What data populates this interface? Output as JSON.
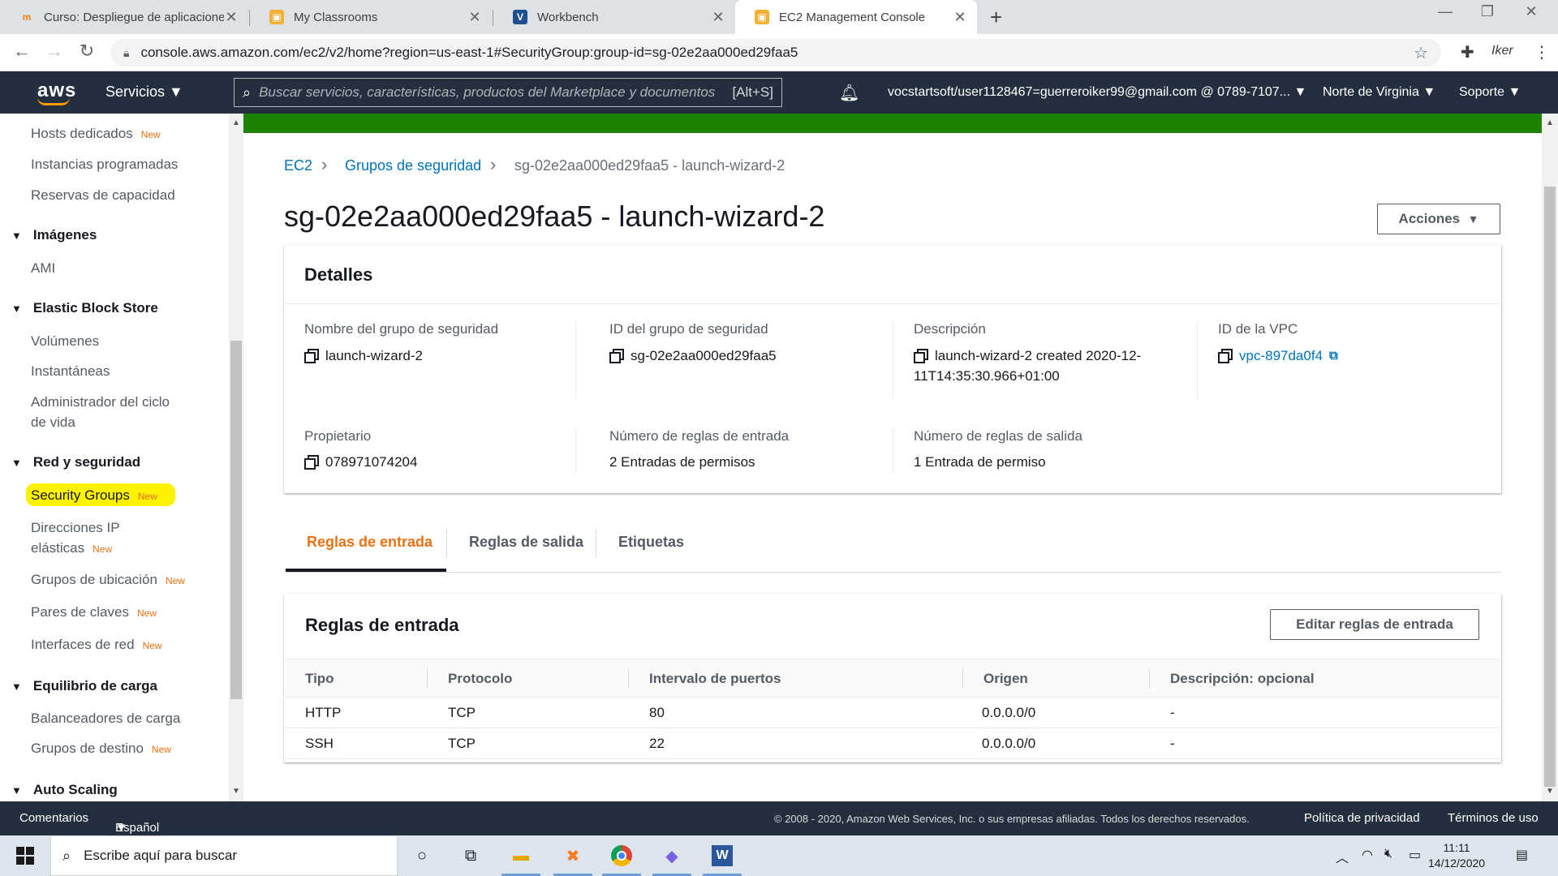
{
  "browser": {
    "tabs": [
      {
        "title": "Curso: Despliegue de aplicacione",
        "icon": "moodle-icon"
      },
      {
        "title": "My Classrooms",
        "icon": "aws-box-icon"
      },
      {
        "title": "Workbench",
        "icon": "vocareum-icon"
      },
      {
        "title": "EC2 Management Console",
        "icon": "aws-box-icon"
      }
    ],
    "url": "console.aws.amazon.com/ec2/v2/home?region=us-east-1#SecurityGroup:group-id=sg-02e2aa000ed29faa5",
    "profile_text": "Iker"
  },
  "aws_header": {
    "logo": "aws",
    "services": "Servicios",
    "search_placeholder": "Buscar servicios, características, productos del Marketplace y documentos",
    "search_shortcut": "[Alt+S]",
    "account": "vocstartsoft/user1128467=guerreroiker99@gmail.com @ 0789-7107...",
    "region": "Norte de Virginia",
    "support": "Soporte"
  },
  "sidebar": {
    "items": [
      {
        "label": "Hosts dedicados",
        "new": "New"
      },
      {
        "label": "Instancias programadas"
      },
      {
        "label": "Reservas de capacidad"
      }
    ],
    "sections": [
      {
        "title": "Imágenes",
        "items": [
          "AMI"
        ]
      },
      {
        "title": "Elastic Block Store",
        "items": [
          "Volúmenes",
          "Instantáneas",
          "Administrador del ciclo",
          "de vida"
        ]
      },
      {
        "title": "Red y seguridad"
      },
      {
        "title": "Equilibrio de carga"
      },
      {
        "title": "Auto Scaling"
      }
    ],
    "network": {
      "security_groups": "Security Groups",
      "eip_line1": "Direcciones IP",
      "eip_line2": "elásticas",
      "placement": "Grupos de ubicación",
      "keypairs": "Pares de claves",
      "interfaces": "Interfaces de red"
    },
    "lb": {
      "balancers": "Balanceadores de carga",
      "targets": "Grupos de destino"
    },
    "new_badge": "New"
  },
  "breadcrumb": {
    "ec2": "EC2",
    "groups": "Grupos de seguridad",
    "current": "sg-02e2aa000ed29faa5 - launch-wizard-2"
  },
  "page": {
    "title": "sg-02e2aa000ed29faa5 - launch-wizard-2",
    "actions": "Acciones"
  },
  "details": {
    "heading": "Detalles",
    "name_label": "Nombre del grupo de seguridad",
    "name_value": "launch-wizard-2",
    "id_label": "ID del grupo de seguridad",
    "id_value": "sg-02e2aa000ed29faa5",
    "desc_label": "Descripción",
    "desc_line1": "launch-wizard-2 created 2020-12-",
    "desc_line2": "11T14:35:30.966+01:00",
    "vpc_label": "ID de la VPC",
    "vpc_value": "vpc-897da0f4",
    "owner_label": "Propietario",
    "owner_value": "078971074204",
    "inbound_count_label": "Número de reglas de entrada",
    "inbound_count_value": "2 Entradas de permisos",
    "outbound_count_label": "Número de reglas de salida",
    "outbound_count_value": "1 Entrada de permiso"
  },
  "tabs": [
    "Reglas de entrada",
    "Reglas de salida",
    "Etiquetas"
  ],
  "rules": {
    "heading": "Reglas de entrada",
    "edit_button": "Editar reglas de entrada",
    "columns": [
      "Tipo",
      "Protocolo",
      "Intervalo de puertos",
      "Origen",
      "Descripción: opcional"
    ],
    "rows": [
      [
        "HTTP",
        "TCP",
        "80",
        "0.0.0.0/0",
        "-"
      ],
      [
        "SSH",
        "TCP",
        "22",
        "0.0.0.0/0",
        "-"
      ]
    ]
  },
  "footer": {
    "feedback": "Comentarios",
    "language": "Español",
    "copyright": "© 2008 - 2020, Amazon Web Services, Inc. o sus empresas afiliadas. Todos los derechos reservados.",
    "privacy": "Política de privacidad",
    "terms": "Términos de uso"
  },
  "taskbar": {
    "search_placeholder": "Escribe aquí para buscar",
    "time": "11:11",
    "date": "14/12/2020"
  },
  "colors": {
    "aws_nav": "#232f3e",
    "accent_orange": "#ec7211",
    "link_blue": "#0073bb",
    "success_green": "#1d8102",
    "highlight_yellow": "#fff200"
  }
}
